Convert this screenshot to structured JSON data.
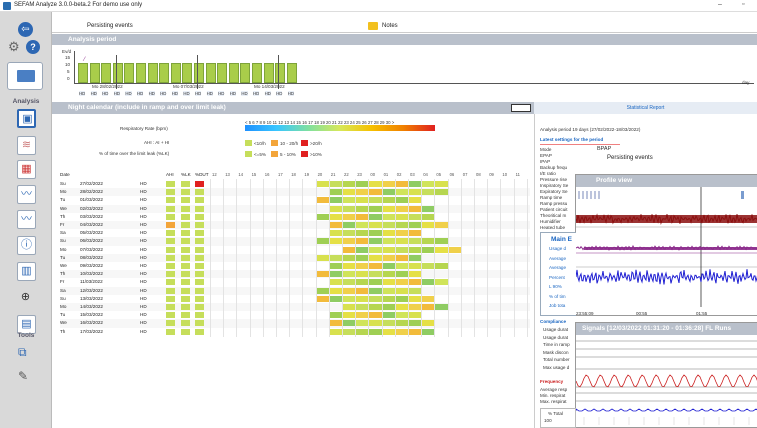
{
  "window": {
    "title": "SEFAM Analyze 3.0.0-beta.2 For demo use only",
    "min": "–",
    "max": "▫"
  },
  "topbar": {
    "persisting": "Persisting events",
    "notes": "Notes"
  },
  "sidebar": {
    "analysis_label": "Analysis",
    "tools_label": "Tools"
  },
  "analysis_period": {
    "title": "Analysis period",
    "ylabel": "Ev/d",
    "yticks": [
      "15",
      "10",
      "5",
      "0"
    ],
    "dates": [
      "Mo 28/02/2022",
      "Mo 07/03/2022",
      "Mo 14/03/2022"
    ],
    "hd_label": "HD",
    "day_label": "day"
  },
  "night_calendar": {
    "title": "Night calendar (include in ramp and over limit leak)",
    "rr_label": "Respiratory Rate (bpm)",
    "rr_scale": "< 5 6 7 8 9 10 11 12 13 14 15 16 17 18 19 20 21 22 23 24 25 26 27 28 29 30 >",
    "ahi_label": "AHI : AI + HI",
    "ahi_legend": [
      "<10/h",
      "10 - 20/h",
      ">20/h"
    ],
    "lk_label": "% of time over the limit leak (%LK)",
    "lk_legend": [
      "<=5%",
      "5 - 10%",
      ">10%"
    ],
    "col_headers": [
      "Date",
      "AHI",
      "%LK",
      "%DUT"
    ],
    "hours": [
      "12",
      "13",
      "14",
      "15",
      "16",
      "17",
      "18",
      "19",
      "20",
      "21",
      "22",
      "23",
      "00",
      "01",
      "02",
      "03",
      "04",
      "05",
      "06",
      "07",
      "08",
      "09",
      "10",
      "11"
    ],
    "rows": [
      {
        "day": "Su",
        "date": "27/02/2022",
        "mode": "HD"
      },
      {
        "day": "Mo",
        "date": "28/02/2022",
        "mode": "HD"
      },
      {
        "day": "Tu",
        "date": "01/03/2022",
        "mode": "HD"
      },
      {
        "day": "We",
        "date": "02/03/2022",
        "mode": "HD"
      },
      {
        "day": "Th",
        "date": "03/03/2022",
        "mode": "HD"
      },
      {
        "day": "Fr",
        "date": "04/03/2022",
        "mode": "HD"
      },
      {
        "day": "Sa",
        "date": "05/03/2022",
        "mode": "HD"
      },
      {
        "day": "Su",
        "date": "06/03/2022",
        "mode": "HD"
      },
      {
        "day": "Mo",
        "date": "07/03/2022",
        "mode": "HD"
      },
      {
        "day": "Tu",
        "date": "08/03/2022",
        "mode": "HD"
      },
      {
        "day": "We",
        "date": "09/03/2022",
        "mode": "HD"
      },
      {
        "day": "Th",
        "date": "10/03/2022",
        "mode": "HD"
      },
      {
        "day": "Fr",
        "date": "11/03/2022",
        "mode": "HD"
      },
      {
        "day": "Sa",
        "date": "12/03/2022",
        "mode": "HD"
      },
      {
        "day": "Su",
        "date": "13/03/2022",
        "mode": "HD"
      },
      {
        "day": "Mo",
        "date": "14/03/2022",
        "mode": "HD"
      },
      {
        "day": "Tu",
        "date": "15/03/2022",
        "mode": "HD"
      },
      {
        "day": "We",
        "date": "16/03/2022",
        "mode": "HD"
      },
      {
        "day": "Th",
        "date": "17/03/2022",
        "mode": "HD"
      }
    ]
  },
  "statistical_report": {
    "title": "Statistical Report",
    "analysis_period": "Analysis period   19 days (27/02/2022-18/03/2022)",
    "latest_settings": "Latest settings for the period",
    "mode_label": "Mode",
    "mode_value": "BPAP",
    "settings_rows": [
      "EPAP",
      "IPAP",
      "Backup frequ",
      "I/E ratio",
      "Pressure rise",
      "Inspiratory Se",
      "Expiratory Se",
      "Ramp time",
      "Ramp pressu",
      "Patient circuit",
      "Theoritical m",
      "Humidifier",
      "Heated tube"
    ],
    "persisting": "Persisting events",
    "profile_view": "Profile view",
    "main_label": "Main E",
    "main_rows": [
      "Usage d",
      "Average",
      "Average",
      "Percent",
      "L 90%",
      "% of tim",
      "Job tota"
    ],
    "time_ticks": [
      "23:55:09",
      "00:55",
      "01:55"
    ],
    "compliance": "Compliance",
    "compliance_rows": [
      "Usage durat",
      "Usage durat",
      "Time in ramp",
      "Mask discon",
      "Total number",
      "Max usage d"
    ],
    "signals": "Signals  [12/03/2022 01:31:20 - 01:36:28]  FL Runs",
    "frequency": "Frequency",
    "frequency_rows": [
      "Average resp",
      "Min. respirat",
      "Max. respirat"
    ],
    "total_label": "% Total",
    "total_value": "100"
  },
  "colors": {
    "header_gray": "#b9c0cb",
    "accent_blue": "#1a66c2",
    "profile_red": "#8b0f0f",
    "profile_purple": "#8b2a8b",
    "profile_blue": "#1e1ed2"
  }
}
